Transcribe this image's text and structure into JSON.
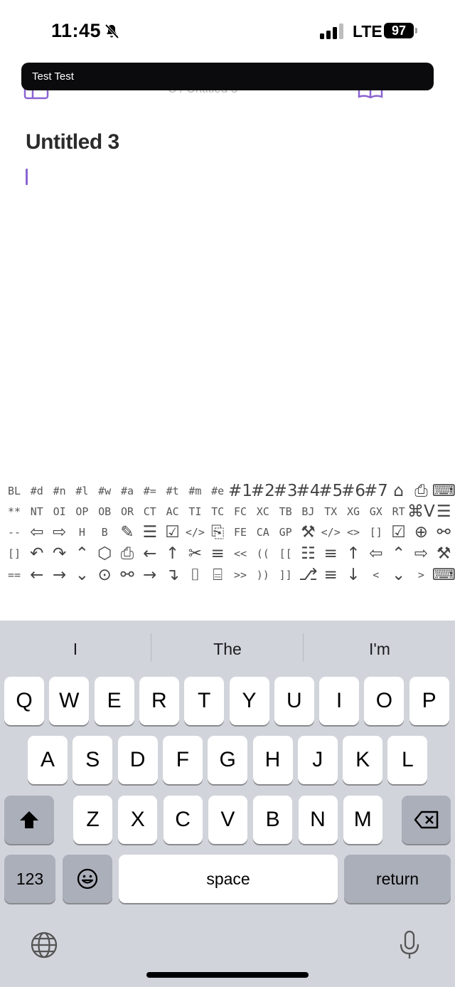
{
  "status_bar": {
    "time": "11:45",
    "network": "LTE",
    "battery": "97"
  },
  "banner": {
    "text": "Test Test"
  },
  "nav": {
    "breadcrumb": "C / Untitled 3"
  },
  "document": {
    "title": "Untitled 3"
  },
  "toolbar": {
    "rows": [
      [
        "BL",
        "#d",
        "#n",
        "#l",
        "#w",
        "#a",
        "#=",
        "#t",
        "#m",
        "#e",
        "#1",
        "#2",
        "#3",
        "#4",
        "#5",
        "#6",
        "#7",
        "⌂",
        "⎙",
        "⌨"
      ],
      [
        "**",
        "NT",
        "OI",
        "OP",
        "OB",
        "OR",
        "CT",
        "AC",
        "TI",
        "TC",
        "FC",
        "XC",
        "TB",
        "BJ",
        "TX",
        "XG",
        "GX",
        "RT",
        "⌘V",
        "☰"
      ],
      [
        "--",
        "⇦",
        "⇨",
        "H",
        "B",
        "✎",
        "☰",
        "☑",
        "</>",
        "⎘",
        "FE",
        "CA",
        "GP",
        "⚒",
        "</>",
        "<>",
        "[]",
        "☑",
        "⊕",
        "⚯"
      ],
      [
        "[]",
        "↶",
        "↷",
        "⌃",
        "⬡",
        "⎙",
        "←",
        "↑",
        "✂",
        "≡",
        "<<",
        "((",
        "[[",
        "☷",
        "≡",
        "↑",
        "⇦",
        "⌃",
        "⇨",
        "⚒"
      ],
      [
        "==",
        "←",
        "→",
        "⌄",
        "⊙",
        "⚯",
        "→",
        "↴",
        "⌷",
        "⌸",
        ">>",
        "))",
        "]]",
        "⎇",
        "≡",
        "↓",
        "<",
        "⌄",
        ">",
        "⌨"
      ]
    ]
  },
  "keyboard": {
    "suggestions": [
      "I",
      "The",
      "I'm"
    ],
    "row1": [
      "Q",
      "W",
      "E",
      "R",
      "T",
      "Y",
      "U",
      "I",
      "O",
      "P"
    ],
    "row2": [
      "A",
      "S",
      "D",
      "F",
      "G",
      "H",
      "J",
      "K",
      "L"
    ],
    "row3": [
      "Z",
      "X",
      "C",
      "V",
      "B",
      "N",
      "M"
    ],
    "numbers_label": "123",
    "space_label": "space",
    "return_label": "return"
  },
  "colors": {
    "accent": "#8a63d2",
    "keyboard_bg": "#d1d4db",
    "banner_bg": "#0b0b0d"
  }
}
